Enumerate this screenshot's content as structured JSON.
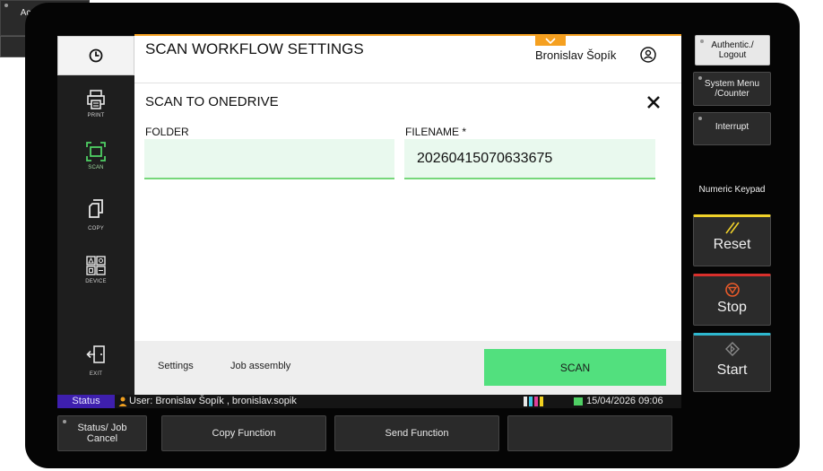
{
  "screen": {
    "title": "SCAN WORKFLOW SETTINGS",
    "user_name": "Bronislav Šopík",
    "panel_title": "SCAN TO ONEDRIVE",
    "folder": {
      "label": "FOLDER",
      "value": ""
    },
    "filename": {
      "label": "FILENAME *",
      "value": "20260415070633675"
    },
    "footer": {
      "settings_label": "Settings",
      "job_assembly_label": "Job assembly",
      "scan_label": "SCAN"
    }
  },
  "left_nav": {
    "items": [
      {
        "label": "PRINT",
        "icon": "printer-icon"
      },
      {
        "label": "SCAN",
        "icon": "scan-icon",
        "active": true
      },
      {
        "label": "COPY",
        "icon": "copy-icon"
      },
      {
        "label": "DEVICE",
        "icon": "device-icon"
      },
      {
        "label": "EXIT",
        "icon": "exit-icon"
      }
    ]
  },
  "status_bar": {
    "tag": "Status",
    "user_text": "User: Bronislav Šopík , bronislav.sopik",
    "datetime": "15/04/2026  09:06"
  },
  "function_row": {
    "status_job_cancel": "Status/ Job Cancel",
    "copy_function": "Copy Function",
    "send_function": "Send Function",
    "accessibility": "Accessibility Display"
  },
  "hardware": {
    "auth": "Authentic./ Logout",
    "system_menu": "System Menu /Counter",
    "interrupt": "Interrupt",
    "numeric_keypad": "Numeric Keypad",
    "reset": "Reset",
    "stop": "Stop",
    "start": "Start"
  },
  "colors": {
    "accent_green": "#52e07e",
    "field_bg": "#e9f9ee",
    "status_tag": "#3e1fae",
    "notification_orange": "#f5a020",
    "reset_yellow": "#f1d22a",
    "stop_red": "#d9302c",
    "start_cyan": "#2eb8cf"
  }
}
